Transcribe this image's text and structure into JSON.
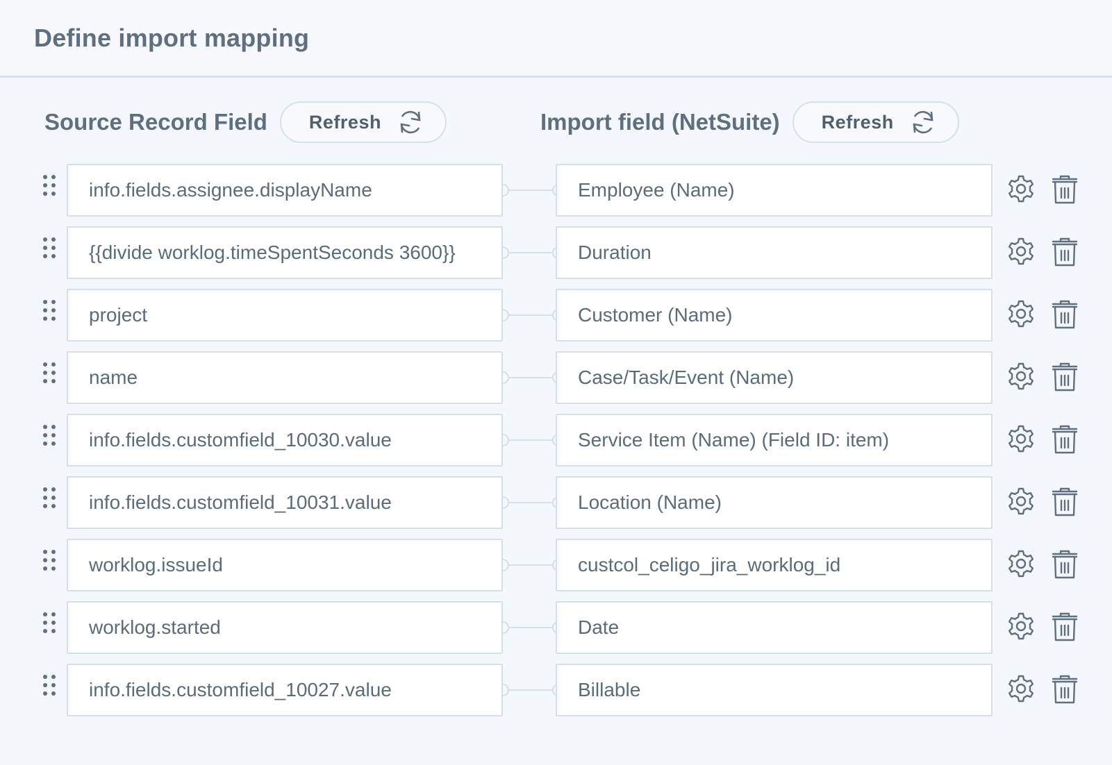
{
  "page": {
    "title": "Define import mapping"
  },
  "source_column": {
    "title": "Source Record Field",
    "refresh_label": "Refresh"
  },
  "import_column": {
    "title": "Import field (NetSuite)",
    "refresh_label": "Refresh"
  },
  "mappings": [
    {
      "source": "info.fields.assignee.displayName",
      "target": "Employee (Name)"
    },
    {
      "source": "{{divide worklog.timeSpentSeconds 3600}}",
      "target": "Duration"
    },
    {
      "source": "project",
      "target": "Customer (Name)"
    },
    {
      "source": "name",
      "target": "Case/Task/Event (Name)"
    },
    {
      "source": "info.fields.customfield_10030.value",
      "target": "Service Item (Name) (Field ID: item)"
    },
    {
      "source": "info.fields.customfield_10031.value",
      "target": "Location (Name)"
    },
    {
      "source": "worklog.issueId",
      "target": "custcol_celigo_jira_worklog_id"
    },
    {
      "source": "worklog.started",
      "target": "Date"
    },
    {
      "source": "info.fields.customfield_10027.value",
      "target": "Billable"
    }
  ],
  "icons": {
    "drag": "drag-handle-icon",
    "settings": "gear-icon",
    "delete": "trash-icon",
    "refresh": "refresh-icon"
  },
  "colors": {
    "background": "#f4f7fb",
    "border": "#d4dfea",
    "text": "#5c6b7a",
    "icon": "#5f6f7f"
  }
}
